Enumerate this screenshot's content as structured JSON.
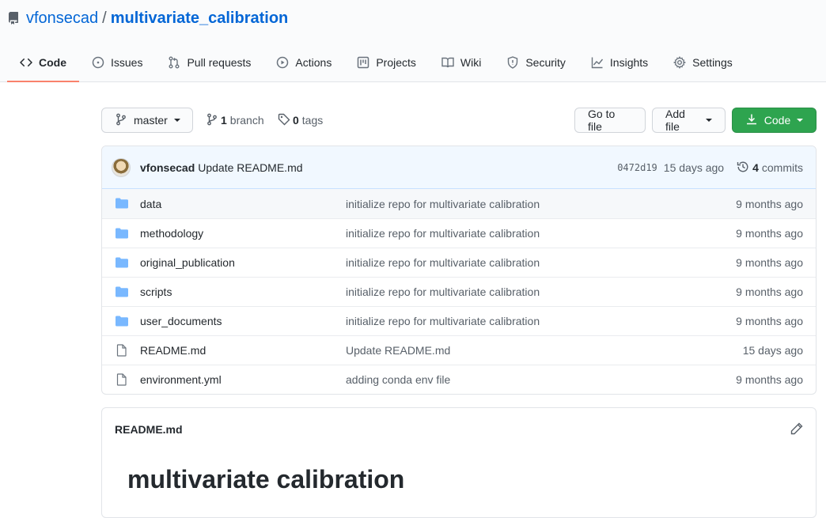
{
  "repo": {
    "owner": "vfonsecad",
    "separator": "/",
    "name": "multivariate_calibration"
  },
  "tabs": [
    {
      "label": "Code",
      "icon": "code-icon",
      "selected": true
    },
    {
      "label": "Issues",
      "icon": "issue-icon"
    },
    {
      "label": "Pull requests",
      "icon": "pull-request-icon"
    },
    {
      "label": "Actions",
      "icon": "play-icon"
    },
    {
      "label": "Projects",
      "icon": "project-icon"
    },
    {
      "label": "Wiki",
      "icon": "book-icon"
    },
    {
      "label": "Security",
      "icon": "shield-icon"
    },
    {
      "label": "Insights",
      "icon": "graph-icon"
    },
    {
      "label": "Settings",
      "icon": "gear-icon"
    }
  ],
  "toolbar": {
    "branch_name": "master",
    "branch_count": "1",
    "branch_label": "branch",
    "tag_count": "0",
    "tag_label": "tags",
    "go_to_file": "Go to file",
    "add_file": "Add file",
    "code": "Code"
  },
  "commit": {
    "author": "vfonsecad",
    "message": "Update README.md",
    "sha": "0472d19",
    "age": "15 days ago",
    "count": "4",
    "count_label": "commits"
  },
  "files": [
    {
      "type": "dir",
      "name": "data",
      "message": "initialize repo for multivariate calibration",
      "age": "9 months ago"
    },
    {
      "type": "dir",
      "name": "methodology",
      "message": "initialize repo for multivariate calibration",
      "age": "9 months ago"
    },
    {
      "type": "dir",
      "name": "original_publication",
      "message": "initialize repo for multivariate calibration",
      "age": "9 months ago"
    },
    {
      "type": "dir",
      "name": "scripts",
      "message": "initialize repo for multivariate calibration",
      "age": "9 months ago"
    },
    {
      "type": "dir",
      "name": "user_documents",
      "message": "initialize repo for multivariate calibration",
      "age": "9 months ago"
    },
    {
      "type": "file",
      "name": "README.md",
      "message": "Update README.md",
      "age": "15 days ago"
    },
    {
      "type": "file",
      "name": "environment.yml",
      "message": "adding conda env file",
      "age": "9 months ago"
    }
  ],
  "readme": {
    "filename": "README.md",
    "heading": "multivariate calibration"
  },
  "colors": {
    "accent": "#0366d6",
    "tab_underline": "#f9826c",
    "code_button": "#2ea44f",
    "folder": "#79b8ff"
  }
}
